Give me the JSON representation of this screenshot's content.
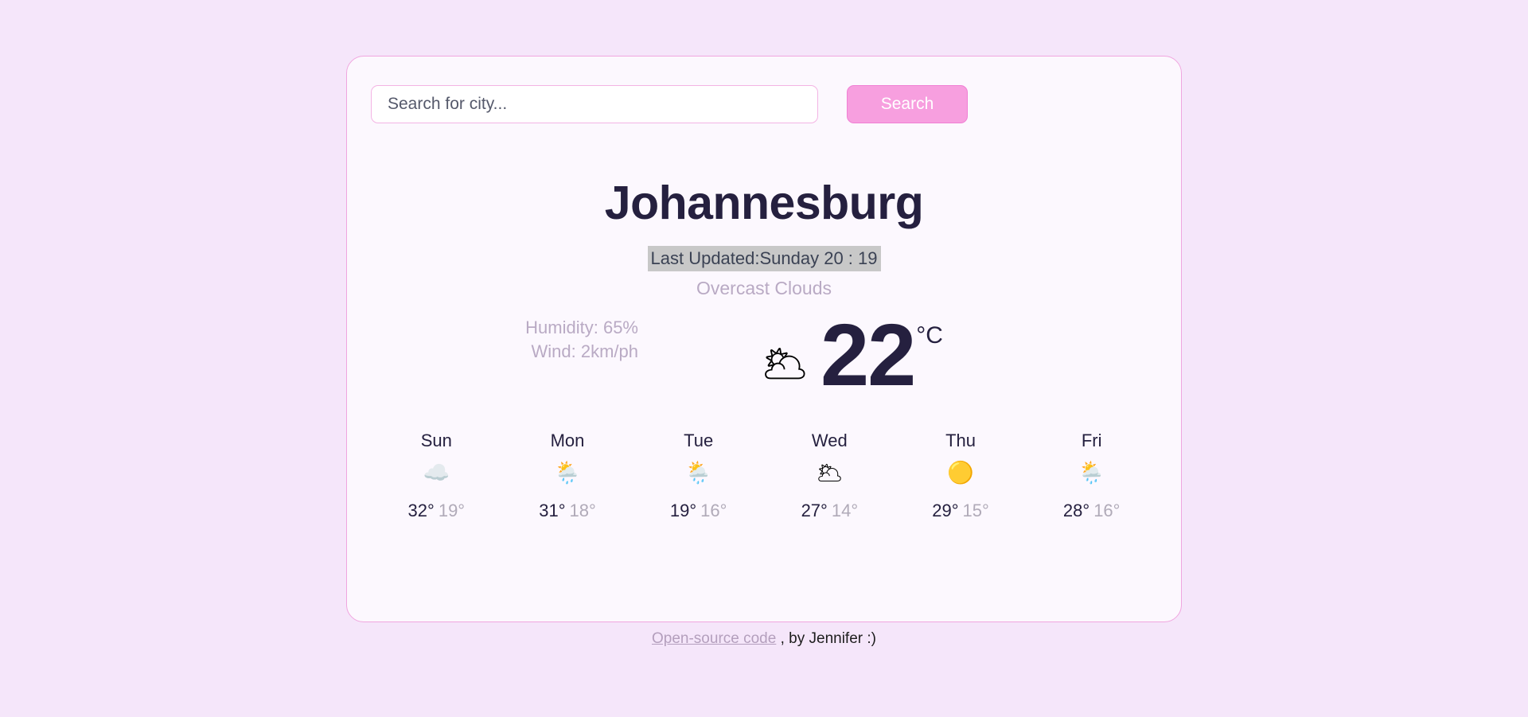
{
  "search": {
    "placeholder": "Search for city...",
    "value": "",
    "button_label": "Search"
  },
  "current": {
    "city": "Johannesburg",
    "last_updated": "Last Updated:Sunday 20 : 19",
    "condition": "Overcast Clouds",
    "humidity_label": "Humidity: 65%",
    "wind_label": "Wind: 2km/ph",
    "temperature": "22",
    "unit": "°C",
    "icon": "overcast-clouds-icon",
    "icon_glyph": "🌥"
  },
  "forecast": {
    "days": [
      {
        "name": "Sun",
        "icon": "cloud-icon",
        "icon_glyph": "☁️",
        "high": "32°",
        "low": "19°"
      },
      {
        "name": "Mon",
        "icon": "sun-behind-rain-cloud-icon",
        "icon_glyph": "🌦️",
        "high": "31°",
        "low": "18°"
      },
      {
        "name": "Tue",
        "icon": "sun-behind-rain-cloud-icon",
        "icon_glyph": "🌦️",
        "high": "19°",
        "low": "16°"
      },
      {
        "name": "Wed",
        "icon": "broken-clouds-icon",
        "icon_glyph": "🌥",
        "high": "27°",
        "low": "14°"
      },
      {
        "name": "Thu",
        "icon": "sun-icon",
        "icon_glyph": "🟡",
        "high": "29°",
        "low": "15°"
      },
      {
        "name": "Fri",
        "icon": "sun-behind-rain-cloud-icon",
        "icon_glyph": "🌦️",
        "high": "28°",
        "low": "16°"
      }
    ]
  },
  "footer": {
    "link_text": "Open-source code",
    "credit_text": " , by Jennifer :)"
  },
  "colors": {
    "page_background": "#f5e6fa",
    "card_background": "#fcf8fe",
    "card_border": "#f0a6df",
    "accent_button": "#f79fdf",
    "heading_text": "#25203f",
    "muted_text": "#b9aac4",
    "selection_highlight": "#c8c8c8"
  }
}
